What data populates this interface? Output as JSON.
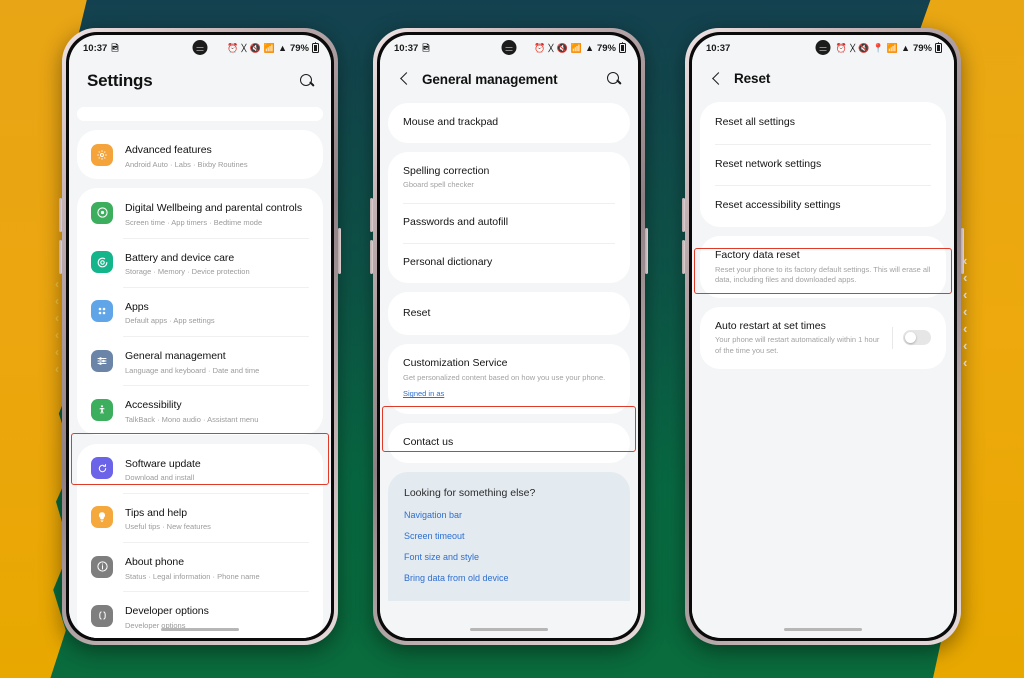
{
  "background": {
    "accent_orange": "#e9a70f",
    "teal_top": "#14414f",
    "green_bottom": "#0a6b3c",
    "chevron_glyph": "‹"
  },
  "highlight_color": "#e03a28",
  "status_bar": {
    "time": "10:37",
    "battery_percent": "79%",
    "icons_phone1": [
      "image-icon",
      "alarm-icon",
      "bluetooth-icon",
      "mute-icon",
      "wifi-icon",
      "signal-icon"
    ],
    "icons_phone3": [
      "alarm-icon",
      "bluetooth-icon",
      "mute-icon",
      "location-icon",
      "wifi-icon",
      "signal-icon"
    ]
  },
  "phone1": {
    "header": {
      "title": "Settings",
      "search_icon": "search-icon"
    },
    "groups": [
      {
        "items": [
          {
            "title": "Advanced features",
            "subtitle": "Android Auto  ·  Labs  ·  Bixby Routines",
            "icon": "advanced-features-icon",
            "color": "#f5a43c"
          }
        ]
      },
      {
        "items": [
          {
            "title": "Digital Wellbeing and parental controls",
            "subtitle": "Screen time  ·  App timers  ·  Bedtime mode",
            "icon": "digital-wellbeing-icon",
            "color": "#3cae5e"
          },
          {
            "title": "Battery and device care",
            "subtitle": "Storage  ·  Memory  ·  Device protection",
            "icon": "battery-care-icon",
            "color": "#14b58a"
          },
          {
            "title": "Apps",
            "subtitle": "Default apps  ·  App settings",
            "icon": "apps-icon",
            "color": "#60a5e8"
          },
          {
            "title": "General management",
            "subtitle": "Language and keyboard  ·  Date and time",
            "icon": "general-management-icon",
            "color": "#6b85a8",
            "highlighted": true
          },
          {
            "title": "Accessibility",
            "subtitle": "TalkBack  ·  Mono audio  ·  Assistant menu",
            "icon": "accessibility-icon",
            "color": "#3cae5e"
          }
        ]
      },
      {
        "items": [
          {
            "title": "Software update",
            "subtitle": "Download and install",
            "icon": "software-update-icon",
            "color": "#6b63e8"
          },
          {
            "title": "Tips and help",
            "subtitle": "Useful tips  ·  New features",
            "icon": "tips-help-icon",
            "color": "#f5a83c"
          },
          {
            "title": "About phone",
            "subtitle": "Status  ·  Legal information  ·  Phone name",
            "icon": "about-phone-icon",
            "color": "#7e7e7e"
          },
          {
            "title": "Developer options",
            "subtitle": "Developer options",
            "icon": "developer-options-icon",
            "color": "#7e7e7e"
          }
        ]
      }
    ]
  },
  "phone2": {
    "header": {
      "title": "General management",
      "back_icon": "back-arrow-icon",
      "search_icon": "search-icon"
    },
    "groups": [
      {
        "items": [
          {
            "title": "Mouse and trackpad"
          }
        ]
      },
      {
        "items": [
          {
            "title": "Spelling correction",
            "subtitle": "Gboard spell checker"
          },
          {
            "title": "Passwords and autofill"
          },
          {
            "title": "Personal dictionary"
          }
        ]
      },
      {
        "items": [
          {
            "title": "Reset",
            "highlighted": true
          }
        ]
      },
      {
        "items": [
          {
            "title": "Customization Service",
            "subtitle": "Get personalized content based on how you use your phone.",
            "link": "Signed in as"
          }
        ]
      },
      {
        "items": [
          {
            "title": "Contact us"
          }
        ]
      }
    ],
    "suggestions": {
      "heading": "Looking for something else?",
      "links": [
        "Navigation bar",
        "Screen timeout",
        "Font size and style",
        "Bring data from old device"
      ]
    }
  },
  "phone3": {
    "header": {
      "title": "Reset",
      "back_icon": "back-arrow-icon"
    },
    "groups": [
      {
        "items": [
          {
            "title": "Reset all settings"
          },
          {
            "title": "Reset network settings",
            "highlighted": true
          },
          {
            "title": "Reset accessibility settings"
          }
        ]
      },
      {
        "items": [
          {
            "title": "Factory data reset",
            "subtitle": "Reset your phone to its factory default settings. This will erase all data, including files and downloaded apps."
          }
        ]
      },
      {
        "items": [
          {
            "title": "Auto restart at set times",
            "subtitle": "Your phone will restart automatically within 1 hour of the time you set.",
            "toggle": "off"
          }
        ]
      }
    ]
  }
}
